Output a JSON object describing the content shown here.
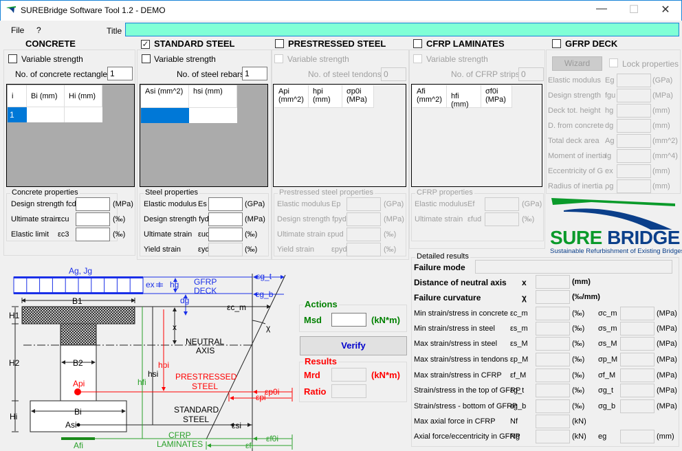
{
  "window": {
    "title": "SUREBridge Software Tool 1.2 - DEMO",
    "minimize": "—",
    "maximize": "☐",
    "close": "✕"
  },
  "menu": {
    "file": "File",
    "help": "?",
    "title_label": "Title",
    "title_value": ""
  },
  "concrete": {
    "header": "CONCRETE",
    "variable_strength": "Variable strength",
    "count_label": "No. of concrete rectangles",
    "count": "1",
    "columns": [
      "i",
      "Bi (mm)",
      "Hi (mm)"
    ],
    "rows": [
      [
        "1",
        "",
        ""
      ]
    ],
    "props_title": "Concrete properties",
    "props": [
      {
        "label": "Design strength fcd",
        "sym": "",
        "unit": "(MPa)"
      },
      {
        "label": "Ultimate strain",
        "sym": "εcu",
        "unit": "(‰)"
      },
      {
        "label": "Elastic limit",
        "sym": "εc3",
        "unit": "(‰)"
      }
    ]
  },
  "steel": {
    "header": "STANDARD STEEL",
    "checked": true,
    "variable_strength": "Variable strength",
    "count_label": "No. of steel rebars",
    "count": "1",
    "columns": [
      "Asi (mm^2)",
      "hsi (mm)"
    ],
    "rows": [
      [
        "",
        ""
      ]
    ],
    "props_title": "Steel properties",
    "props": [
      {
        "label": "Elastic modulus",
        "sym": "Es",
        "unit": "(GPa)"
      },
      {
        "label": "Design strength fyd",
        "sym": "",
        "unit": "(MPa)"
      },
      {
        "label": "Ultimate strain",
        "sym": "εud",
        "unit": "(‰)"
      },
      {
        "label": "Yield strain",
        "sym": "εyd",
        "unit": "(‰)",
        "disabled": true
      }
    ]
  },
  "prestressed": {
    "header": "PRESTRESSED STEEL",
    "checked": false,
    "variable_strength": "Variable strength",
    "count_label": "No. of steel tendons:",
    "count": "0",
    "columns": [
      "Api (mm^2)",
      "hpi (mm)",
      "σp0i (MPa)"
    ],
    "props_title": "Prestressed steel properties",
    "props": [
      {
        "label": "Elastic modulus",
        "sym": "Ep",
        "unit": "(GPa)"
      },
      {
        "label": "Design strength fpyd",
        "sym": "",
        "unit": "(MPa)"
      },
      {
        "label": "Ultimate strain εpud",
        "sym": "",
        "unit": "(‰)"
      },
      {
        "label": "Yield strain",
        "sym": "εpyd",
        "unit": "(‰)"
      }
    ]
  },
  "cfrp": {
    "header": "CFRP LAMINATES",
    "checked": false,
    "variable_strength": "Variable strength",
    "count_label": "No. of CFRP strips:",
    "count": "0",
    "columns": [
      "Afi (mm^2)",
      "hfi (mm)",
      "σf0i (MPa)"
    ],
    "props_title": "CFRP properties",
    "props": [
      {
        "label": "Elastic modulus",
        "sym": "Ef",
        "unit": "(GPa)"
      },
      {
        "label": "Ultimate strain",
        "sym": "εfud",
        "unit": "(‰)"
      }
    ]
  },
  "gfrp": {
    "header": "GFRP DECK",
    "checked": false,
    "wizard": "Wizard",
    "lock": "Lock properties",
    "props": [
      {
        "label": "Elastic modulus",
        "sym": "Eg",
        "unit": "(GPa)"
      },
      {
        "label": "Design strength",
        "sym": "fgu",
        "unit": "(MPa)"
      },
      {
        "label": "Deck tot. height",
        "sym": "hg",
        "unit": "(mm)"
      },
      {
        "label": "D. from concrete",
        "sym": "dg",
        "unit": "(mm)"
      },
      {
        "label": "Total deck area",
        "sym": "Ag",
        "unit": "(mm^2)"
      },
      {
        "label": "Moment of inertia",
        "sym": "Ig",
        "unit": "(mm^4)"
      },
      {
        "label": "Eccentricity of G",
        "sym": "ex",
        "unit": "(mm)"
      },
      {
        "label": "Radius of inertia",
        "sym": "ρg",
        "unit": "(mm)"
      }
    ]
  },
  "logo": {
    "word1": "SURE",
    "word2": "BRIDGE",
    "tagline": "Sustainable Refurbishment of Existing Bridges",
    "green": "#0a9a2a",
    "blue": "#0b3f8a"
  },
  "actions": {
    "title": "Actions",
    "msd": "Msd",
    "unit": "(kN*m)",
    "verify": "Verify"
  },
  "results": {
    "title": "Results",
    "mrd": "Mrd",
    "unit": "(kN*m)",
    "ratio": "Ratio"
  },
  "detailed": {
    "title": "Detailed results",
    "failure_mode": "Failure mode",
    "neutral_axis": {
      "label": "Distance of neutral axis",
      "sym": "x",
      "unit": "(mm)"
    },
    "curvature": {
      "label": "Failure curvature",
      "sym": "χ",
      "unit": "(‰/mm)"
    },
    "rows": [
      {
        "label": "Min strain/stress in concrete",
        "sym": "εc_m",
        "unit": "(‰)",
        "sym2": "σc_m",
        "unit2": "(MPa)"
      },
      {
        "label": "Min strain/stress in steel",
        "sym": "εs_m",
        "unit": "(‰)",
        "sym2": "σs_m",
        "unit2": "(MPa)"
      },
      {
        "label": "Max strain/stress in steel",
        "sym": "εs_M",
        "unit": "(‰)",
        "sym2": "σs_M",
        "unit2": "(MPa)"
      },
      {
        "label": "Max strain/stress in tendons",
        "sym": "εp_M",
        "unit": "(‰)",
        "sym2": "σp_M",
        "unit2": "(MPa)"
      },
      {
        "label": "Max strain/stress in CFRP",
        "sym": "εf_M",
        "unit": "(‰)",
        "sym2": "σf_M",
        "unit2": "(MPa)"
      },
      {
        "label": "Strain/stress in the top of GFRP",
        "sym": "εg_t",
        "unit": "(‰)",
        "sym2": "σg_t",
        "unit2": "(MPa)"
      },
      {
        "label": "Strain/stress -  bottom of GFRP",
        "sym": "εg_b",
        "unit": "(‰)",
        "sym2": "σg_b",
        "unit2": "(MPa)"
      },
      {
        "label": "Max axial force in CFRP",
        "sym": "Nf",
        "unit": "(kN)"
      },
      {
        "label": "Axial force/eccentricity in GFRP",
        "sym": "Ng",
        "unit": "(kN)",
        "sym2": "eg",
        "unit2": "(mm)"
      }
    ]
  },
  "diagram": {
    "ag_jg": "Ag, Jg",
    "ex": "ex",
    "hg": "hg",
    "gfrp1": "GFRP",
    "gfrp2": "DECK",
    "dg": "dg",
    "b1": "B1",
    "b2": "B2",
    "bi": "Bi",
    "h1": "H1",
    "h2": "H2",
    "hi": "Hi",
    "x": "x",
    "ecm": "εc_m",
    "egt": "εg_t",
    "egb": "εg_b",
    "chi": "χ",
    "na1": "NEUTRAL",
    "na2": "AXIS",
    "hfi": "hfi",
    "hsi": "hsi",
    "hpi": "hpi",
    "api": "Api",
    "asi": "Asi",
    "afi": "Afi",
    "ps1": "PRESTRESSED",
    "ps2": "STEEL",
    "ss1": "STANDARD",
    "ss2": "STEEL",
    "cf1": "CFRP",
    "cf2": "LAMINATES",
    "ep0i": "εp0i",
    "epi": "εpi",
    "esi": "εsi",
    "ef0i": "εf0i",
    "efi": "εfi"
  },
  "colors": {
    "title_input": "#80ffd6",
    "selection": "#0078d7",
    "actions": "#008000",
    "results": "#ff0000",
    "verify": "#0000cc",
    "gfrp": "#1a2fe8"
  }
}
